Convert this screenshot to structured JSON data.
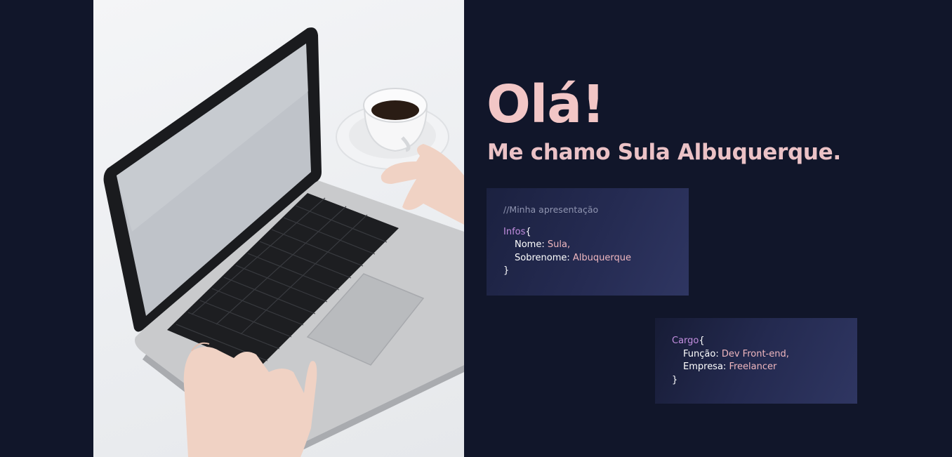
{
  "hero": {
    "greeting": "Olá!",
    "subtitle": "Me chamo Sula Albuquerque."
  },
  "card_infos": {
    "comment": "//Minha apresentação",
    "object_name": "Infos",
    "open_brace": "{",
    "close_brace": "}",
    "fields": [
      {
        "key": "Nome:",
        "value": "Sula,"
      },
      {
        "key": "Sobrenome:",
        "value": "Albuquerque"
      }
    ]
  },
  "card_cargo": {
    "object_name": "Cargo",
    "open_brace": "{",
    "close_brace": "}",
    "fields": [
      {
        "key": "Função:",
        "value": "Dev Front-end,"
      },
      {
        "key": "Empresa:",
        "value": "Freelancer"
      }
    ]
  },
  "colors": {
    "background": "#11162a",
    "accent_pink": "#f2c6c6",
    "keyword_purple": "#c38fe0",
    "value_pink": "#efb7bf",
    "comment_gray": "#8f94b0"
  },
  "image": {
    "subject": "laptop-and-coffee-photo"
  }
}
